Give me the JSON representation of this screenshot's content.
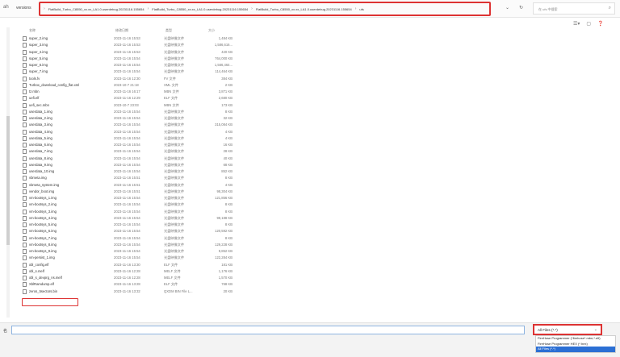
{
  "address": {
    "back": "ah",
    "root": "versions",
    "segments": [
      "FlatBuild_Turbo_C8550_xx.xx_LA1.0.userdebug.20231116.155654",
      "FlatBuild_Turbo_C8550_xx.xx_LA1.0.userdebug.20231116.155654",
      "FlatBuild_Turbo_C8550_xx.xx_LA1.0.userdebug.20231116.155654",
      "ufs"
    ],
    "search_placeholder": "在 ufs 中搜索"
  },
  "columns": {
    "name": "名称",
    "date": "修改日期",
    "type": "类型",
    "size": "大小"
  },
  "files": [
    {
      "name": "super_2.img",
      "date": "2023-11-16 15:53",
      "type": "光盘映像文件",
      "size": "1,484 KB"
    },
    {
      "name": "super_3.img",
      "date": "2023-11-16 15:53",
      "type": "光盘映像文件",
      "size": "1,586,616..."
    },
    {
      "name": "super_4.img",
      "date": "2023-11-16 15:53",
      "type": "光盘映像文件",
      "size": "420 KB"
    },
    {
      "name": "super_5.img",
      "date": "2023-11-16 15:54",
      "type": "光盘映像文件",
      "size": "764,000 KB"
    },
    {
      "name": "super_6.img",
      "date": "2023-11-16 15:54",
      "type": "光盘映像文件",
      "size": "1,566,464..."
    },
    {
      "name": "super_7.img",
      "date": "2023-11-16 15:54",
      "type": "光盘映像文件",
      "size": "114,464 KB"
    },
    {
      "name": "tools.fv",
      "date": "2023-11-16 12:30",
      "type": "FV 文件",
      "size": "384 KB"
    },
    {
      "name": "Turbox_download_config_flat.xml",
      "date": "2023-10-7 21:18",
      "type": "XML 文件",
      "size": "2 KB"
    },
    {
      "name": "tz.mbn",
      "date": "2023-11-16 16:17",
      "type": "MBN 文件",
      "size": "3,871 KB"
    },
    {
      "name": "uefi.elf",
      "date": "2023-11-16 12:29",
      "type": "ELF 文件",
      "size": "2,680 KB"
    },
    {
      "name": "uefi_sec.mbn",
      "date": "2023-10-7 23:03",
      "type": "MBN 文件",
      "size": "173 KB"
    },
    {
      "name": "userdata_1.img",
      "date": "2023-11-16 15:54",
      "type": "光盘映像文件",
      "size": "8 KB"
    },
    {
      "name": "userdata_2.img",
      "date": "2023-11-16 15:54",
      "type": "光盘映像文件",
      "size": "32 KB"
    },
    {
      "name": "userdata_3.img",
      "date": "2023-11-16 15:54",
      "type": "光盘映像文件",
      "size": "315,084 KB"
    },
    {
      "name": "userdata_4.img",
      "date": "2023-11-16 15:54",
      "type": "光盘映像文件",
      "size": "4 KB"
    },
    {
      "name": "userdata_5.img",
      "date": "2023-11-16 15:54",
      "type": "光盘映像文件",
      "size": "4 KB"
    },
    {
      "name": "userdata_6.img",
      "date": "2023-11-16 15:54",
      "type": "光盘映像文件",
      "size": "16 KB"
    },
    {
      "name": "userdata_7.img",
      "date": "2023-11-16 15:54",
      "type": "光盘映像文件",
      "size": "28 KB"
    },
    {
      "name": "userdata_8.img",
      "date": "2023-11-16 15:54",
      "type": "光盘映像文件",
      "size": "40 KB"
    },
    {
      "name": "userdata_9.img",
      "date": "2023-11-16 15:54",
      "type": "光盘映像文件",
      "size": "68 KB"
    },
    {
      "name": "userdata_10.img",
      "date": "2023-11-16 15:54",
      "type": "光盘映像文件",
      "size": "852 KB"
    },
    {
      "name": "vbmeta.img",
      "date": "2023-11-16 15:51",
      "type": "光盘映像文件",
      "size": "8 KB"
    },
    {
      "name": "vbmeta_system.img",
      "date": "2023-11-16 15:51",
      "type": "光盘映像文件",
      "size": "4 KB"
    },
    {
      "name": "vendor_boot.img",
      "date": "2023-11-16 15:51",
      "type": "光盘映像文件",
      "size": "98,304 KB"
    },
    {
      "name": "vm-bootsys_1.img",
      "date": "2023-11-16 15:54",
      "type": "光盘映像文件",
      "size": "121,856 KB"
    },
    {
      "name": "vm-bootsys_2.img",
      "date": "2023-11-16 15:54",
      "type": "光盘映像文件",
      "size": "8 KB"
    },
    {
      "name": "vm-bootsys_3.img",
      "date": "2023-11-16 15:54",
      "type": "光盘映像文件",
      "size": "8 KB"
    },
    {
      "name": "vm-bootsys_4.img",
      "date": "2023-11-16 15:54",
      "type": "光盘映像文件",
      "size": "99,188 KB"
    },
    {
      "name": "vm-bootsys_5.img",
      "date": "2023-11-16 15:54",
      "type": "光盘映像文件",
      "size": "8 KB"
    },
    {
      "name": "vm-bootsys_6.img",
      "date": "2023-11-16 15:54",
      "type": "光盘映像文件",
      "size": "120,592 KB"
    },
    {
      "name": "vm-bootsys_7.img",
      "date": "2023-11-16 15:54",
      "type": "光盘映像文件",
      "size": "8 KB"
    },
    {
      "name": "vm-bootsys_8.img",
      "date": "2023-11-16 15:54",
      "type": "光盘映像文件",
      "size": "129,228 KB"
    },
    {
      "name": "vm-bootsys_9.img",
      "date": "2023-11-16 15:54",
      "type": "光盘映像文件",
      "size": "9,852 KB"
    },
    {
      "name": "vm-persist_1.img",
      "date": "2023-11-16 15:54",
      "type": "光盘映像文件",
      "size": "122,284 KB"
    },
    {
      "name": "xbl_config.elf",
      "date": "2023-11-16 13:30",
      "type": "ELF 文件",
      "size": "181 KB"
    },
    {
      "name": "xbl_s.melf",
      "date": "2023-11-16 12:28",
      "type": "MELF 文件",
      "size": "1,176 KB"
    },
    {
      "name": "xbl_s_devprg_ns.melf",
      "date": "2023-11-16 12:28",
      "type": "MELF 文件",
      "size": "1,570 KB"
    },
    {
      "name": "XblRamdump.elf",
      "date": "2023-11-16 13:28",
      "type": "ELF 文件",
      "size": "768 KB"
    },
    {
      "name": "zeros_5sectors.bin",
      "date": "2023-11-16 13:32",
      "type": "QXDM BIN File L...",
      "size": "20 KB"
    }
  ],
  "bottom": {
    "filename_label": "名",
    "filter_selected": "All Files (*.*)",
    "filter_options": [
      "FireHose Programmer (*firehose*.mbn;*.elf)",
      "FireHose Programmer HEX (*.hex)",
      "All Files (*.*)"
    ]
  }
}
